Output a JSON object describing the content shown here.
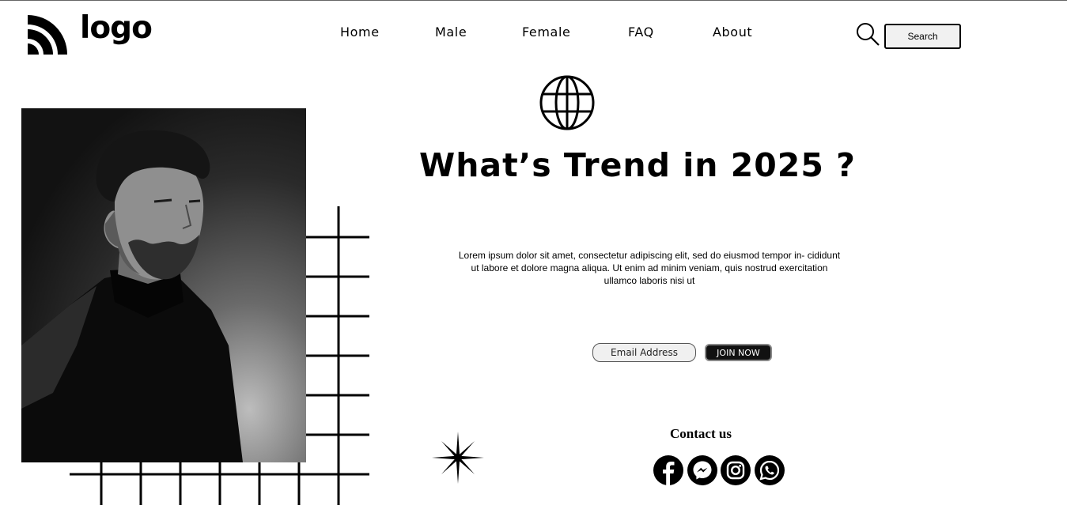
{
  "logo": {
    "text": "logo",
    "icon": "stacked-arc-logo-icon"
  },
  "nav": {
    "items": [
      {
        "label": "Home"
      },
      {
        "label": "Male"
      },
      {
        "label": "Female"
      },
      {
        "label": "FAQ"
      },
      {
        "label": "About"
      }
    ]
  },
  "search": {
    "icon": "search-icon",
    "button_label": "Search"
  },
  "hero": {
    "icon": "globe-icon",
    "headline": "What’s Trend in 2025 ?",
    "body": "Lorem ipsum dolor sit amet, consectetur adipiscing elit, sed do eiusmod tempor in- cididunt ut labore et dolore magna aliqua. Ut enim ad minim veniam, quis nostrud exercitation ullamco laboris nisi ut",
    "image": "portrait-photo"
  },
  "signup": {
    "email_placeholder": "Email Address",
    "join_label": "JOIN NOW"
  },
  "contact": {
    "title": "Contact us",
    "socials": [
      "facebook-icon",
      "messenger-icon",
      "instagram-icon",
      "whatsapp-icon"
    ]
  },
  "colors": {
    "text": "#000000",
    "background": "#ffffff",
    "button_dark": "#111111",
    "button_light": "#f1f1f1"
  }
}
